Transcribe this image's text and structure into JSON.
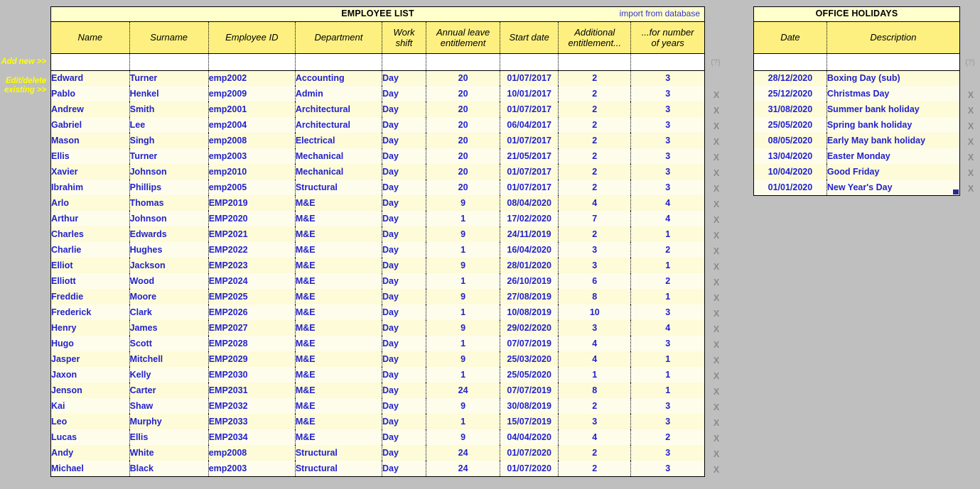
{
  "side_labels": {
    "add_new": "Add new >>",
    "edit_delete": "Edit/delete\nexisting >>",
    "add_new_line1": "Add new >>",
    "edit_line1": "Edit/delete",
    "edit_line2": "existing >>"
  },
  "employee_panel": {
    "title": "EMPLOYEE LIST",
    "import_link": "import from database",
    "help_icon": "(?)",
    "delete_marker": "X",
    "columns": [
      "Name",
      "Surname",
      "Employee ID",
      "Department",
      "Work shift",
      "Annual leave entitlement",
      "Start date",
      "Additional entitlement...",
      "...for number of years"
    ],
    "columns_wrapped": [
      [
        "Name"
      ],
      [
        "Surname"
      ],
      [
        "Employee ID"
      ],
      [
        "Department"
      ],
      [
        "Work",
        "shift"
      ],
      [
        "Annual leave",
        "entitlement"
      ],
      [
        "Start date"
      ],
      [
        "Additional",
        "entitlement..."
      ],
      [
        "...for number",
        "of years"
      ]
    ],
    "new_row_values": [
      "",
      "",
      "",
      "",
      "",
      "",
      "",
      "",
      ""
    ],
    "rows": [
      {
        "name": "Edward",
        "surname": "Turner",
        "id": "emp2002",
        "department": "Accounting",
        "shift": "Day",
        "leave": "20",
        "start": "01/07/2017",
        "additional": "2",
        "years": "3"
      },
      {
        "name": "Pablo",
        "surname": "Henkel",
        "id": "emp2009",
        "department": "Admin",
        "shift": "Day",
        "leave": "20",
        "start": "10/01/2017",
        "additional": "2",
        "years": "3"
      },
      {
        "name": "Andrew",
        "surname": "Smith",
        "id": "emp2001",
        "department": "Architectural",
        "shift": "Day",
        "leave": "20",
        "start": "01/07/2017",
        "additional": "2",
        "years": "3"
      },
      {
        "name": "Gabriel",
        "surname": "Lee",
        "id": "emp2004",
        "department": "Architectural",
        "shift": "Day",
        "leave": "20",
        "start": "06/04/2017",
        "additional": "2",
        "years": "3"
      },
      {
        "name": "Mason",
        "surname": "Singh",
        "id": "emp2008",
        "department": "Electrical",
        "shift": "Day",
        "leave": "20",
        "start": "01/07/2017",
        "additional": "2",
        "years": "3"
      },
      {
        "name": "Ellis",
        "surname": "Turner",
        "id": "emp2003",
        "department": "Mechanical",
        "shift": "Day",
        "leave": "20",
        "start": "21/05/2017",
        "additional": "2",
        "years": "3"
      },
      {
        "name": "Xavier",
        "surname": "Johnson",
        "id": "emp2010",
        "department": "Mechanical",
        "shift": "Day",
        "leave": "20",
        "start": "01/07/2017",
        "additional": "2",
        "years": "3"
      },
      {
        "name": "Ibrahim",
        "surname": "Phillips",
        "id": "emp2005",
        "department": "Structural",
        "shift": "Day",
        "leave": "20",
        "start": "01/07/2017",
        "additional": "2",
        "years": "3"
      },
      {
        "name": "Arlo",
        "surname": "Thomas",
        "id": "EMP2019",
        "department": "M&E",
        "shift": "Day",
        "leave": "9",
        "start": "08/04/2020",
        "additional": "4",
        "years": "4"
      },
      {
        "name": "Arthur",
        "surname": "Johnson",
        "id": "EMP2020",
        "department": "M&E",
        "shift": "Day",
        "leave": "1",
        "start": "17/02/2020",
        "additional": "7",
        "years": "4"
      },
      {
        "name": "Charles",
        "surname": "Edwards",
        "id": "EMP2021",
        "department": "M&E",
        "shift": "Day",
        "leave": "9",
        "start": "24/11/2019",
        "additional": "2",
        "years": "1"
      },
      {
        "name": "Charlie",
        "surname": "Hughes",
        "id": "EMP2022",
        "department": "M&E",
        "shift": "Day",
        "leave": "1",
        "start": "16/04/2020",
        "additional": "3",
        "years": "2"
      },
      {
        "name": "Elliot",
        "surname": "Jackson",
        "id": "EMP2023",
        "department": "M&E",
        "shift": "Day",
        "leave": "9",
        "start": "28/01/2020",
        "additional": "3",
        "years": "1"
      },
      {
        "name": "Elliott",
        "surname": "Wood",
        "id": "EMP2024",
        "department": "M&E",
        "shift": "Day",
        "leave": "1",
        "start": "26/10/2019",
        "additional": "6",
        "years": "2"
      },
      {
        "name": "Freddie",
        "surname": "Moore",
        "id": "EMP2025",
        "department": "M&E",
        "shift": "Day",
        "leave": "9",
        "start": "27/08/2019",
        "additional": "8",
        "years": "1"
      },
      {
        "name": "Frederick",
        "surname": "Clark",
        "id": "EMP2026",
        "department": "M&E",
        "shift": "Day",
        "leave": "1",
        "start": "10/08/2019",
        "additional": "10",
        "years": "3"
      },
      {
        "name": "Henry",
        "surname": "James",
        "id": "EMP2027",
        "department": "M&E",
        "shift": "Day",
        "leave": "9",
        "start": "29/02/2020",
        "additional": "3",
        "years": "4"
      },
      {
        "name": "Hugo",
        "surname": "Scott",
        "id": "EMP2028",
        "department": "M&E",
        "shift": "Day",
        "leave": "1",
        "start": "07/07/2019",
        "additional": "4",
        "years": "3"
      },
      {
        "name": "Jasper",
        "surname": "Mitchell",
        "id": "EMP2029",
        "department": "M&E",
        "shift": "Day",
        "leave": "9",
        "start": "25/03/2020",
        "additional": "4",
        "years": "1"
      },
      {
        "name": "Jaxon",
        "surname": "Kelly",
        "id": "EMP2030",
        "department": "M&E",
        "shift": "Day",
        "leave": "1",
        "start": "25/05/2020",
        "additional": "1",
        "years": "1"
      },
      {
        "name": "Jenson",
        "surname": "Carter",
        "id": "EMP2031",
        "department": "M&E",
        "shift": "Day",
        "leave": "24",
        "start": "07/07/2019",
        "additional": "8",
        "years": "1"
      },
      {
        "name": "Kai",
        "surname": "Shaw",
        "id": "EMP2032",
        "department": "M&E",
        "shift": "Day",
        "leave": "9",
        "start": "30/08/2019",
        "additional": "2",
        "years": "3"
      },
      {
        "name": "Leo",
        "surname": "Murphy",
        "id": "EMP2033",
        "department": "M&E",
        "shift": "Day",
        "leave": "1",
        "start": "15/07/2019",
        "additional": "3",
        "years": "3"
      },
      {
        "name": "Lucas",
        "surname": "Ellis",
        "id": "EMP2034",
        "department": "M&E",
        "shift": "Day",
        "leave": "9",
        "start": "04/04/2020",
        "additional": "4",
        "years": "2"
      },
      {
        "name": "Andy",
        "surname": "White",
        "id": "emp2008",
        "department": "Structural",
        "shift": "Day",
        "leave": "24",
        "start": "01/07/2020",
        "additional": "2",
        "years": "3"
      },
      {
        "name": "Michael",
        "surname": "Black",
        "id": "emp2003",
        "department": "Structural",
        "shift": "Day",
        "leave": "24",
        "start": "01/07/2020",
        "additional": "2",
        "years": "3"
      }
    ]
  },
  "holidays_panel": {
    "title": "OFFICE HOLIDAYS",
    "help_icon": "(?)",
    "delete_marker": "X",
    "columns": [
      "Date",
      "Description"
    ],
    "new_row_values": [
      "",
      ""
    ],
    "rows": [
      {
        "date": "28/12/2020",
        "description": "Boxing Day (sub)"
      },
      {
        "date": "25/12/2020",
        "description": "Christmas Day"
      },
      {
        "date": "31/08/2020",
        "description": "Summer bank holiday"
      },
      {
        "date": "25/05/2020",
        "description": "Spring bank holiday"
      },
      {
        "date": "08/05/2020",
        "description": "Early May bank holiday"
      },
      {
        "date": "13/04/2020",
        "description": "Easter Monday"
      },
      {
        "date": "10/04/2020",
        "description": "Good Friday"
      },
      {
        "date": "01/01/2020",
        "description": "New Year's Day"
      }
    ]
  },
  "colors": {
    "page_background": "#bfbfbf",
    "title_bar": "#ffffcc",
    "header_cell": "#fdf080",
    "row_odd": "#fdfbd8",
    "row_even": "#fefdeb",
    "data_text": "#2222cc",
    "link_text": "#3333cc",
    "side_label_text": "#ffff00",
    "delete_marker": "#8a8a8a"
  }
}
